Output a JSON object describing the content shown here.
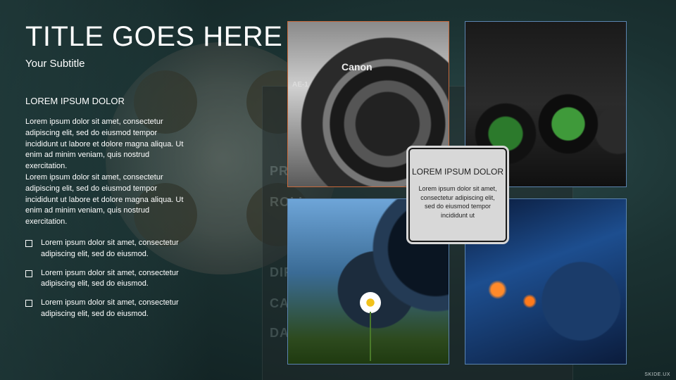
{
  "slide": {
    "title": "TITLE GOES HERE",
    "subtitle": "Your Subtitle",
    "section_heading": "LOREM IPSUM DOLOR",
    "paragraphs": [
      "Lorem ipsum dolor sit amet, consectetur adipiscing elit, sed do eiusmod tempor incididunt ut labore et dolore magna aliqua. Ut enim ad minim veniam, quis nostrud exercitation.",
      "Lorem ipsum dolor sit amet, consectetur adipiscing elit, sed do eiusmod tempor incididunt ut labore et dolore magna aliqua. Ut enim ad minim veniam, quis nostrud exercitation."
    ],
    "bullets": [
      "Lorem ipsum dolor sit amet, consectetur adipiscing elit, sed do eiusmod.",
      "Lorem ipsum dolor sit amet, consectetur adipiscing elit, sed do eiusmod.",
      "Lorem ipsum dolor sit amet, consectetur adipiscing elit, sed do eiusmod."
    ],
    "callout": {
      "title": "LOREM IPSUM DOLOR",
      "text": "Lorem ipsum dolor sit amet, consectetur adipiscing elit, sed do eiusmod tempor incididunt ut"
    },
    "photo_labels": {
      "canon": "Canon",
      "ae1": "AE-1"
    },
    "clapper_rows": [
      "PRO",
      "ROLL",
      "DIR",
      "CAM",
      "DATE"
    ],
    "watermark": "SKIDE.UX"
  },
  "colors": {
    "background": "#1b3232",
    "text": "#ffffff",
    "photo_border_accent": "#c96a3c",
    "photo_border": "#5b84b0",
    "callout_bg": "#d8d8d8"
  }
}
